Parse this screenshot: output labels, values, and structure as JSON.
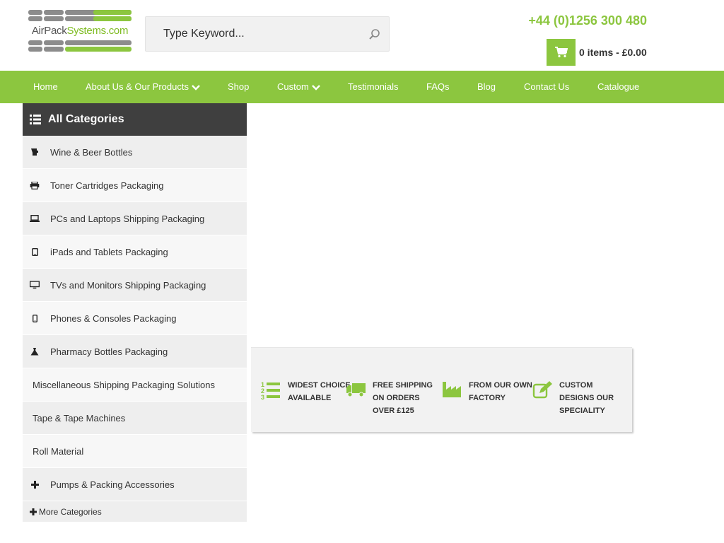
{
  "header": {
    "logo": {
      "left": "AirPack",
      "right": "Systems.com"
    },
    "search": {
      "placeholder": "Type Keyword..."
    },
    "phone": "+44 (0)1256 300 480",
    "cart": {
      "summary": "0 items - £0.00"
    }
  },
  "nav": {
    "items": [
      {
        "label": "Home"
      },
      {
        "label": "About Us & Our Products"
      },
      {
        "label": "Shop"
      },
      {
        "label": "Custom"
      },
      {
        "label": "Testimonials"
      },
      {
        "label": "FAQs"
      },
      {
        "label": "Blog"
      },
      {
        "label": "Contact Us"
      },
      {
        "label": "Catalogue"
      }
    ]
  },
  "sidebar": {
    "title": "All Categories",
    "items": [
      {
        "label": "Wine & Beer Bottles",
        "icon": "bottle-icon"
      },
      {
        "label": "Toner Cartridges Packaging",
        "icon": "printer-icon"
      },
      {
        "label": "PCs and Laptops Shipping Packaging",
        "icon": "laptop-icon"
      },
      {
        "label": "iPads and Tablets Packaging",
        "icon": "tablet-icon"
      },
      {
        "label": "TVs and Monitors Shipping Packaging",
        "icon": "monitor-icon"
      },
      {
        "label": "Phones & Consoles Packaging",
        "icon": "phone-icon"
      },
      {
        "label": "Pharmacy Bottles Packaging",
        "icon": "flask-icon"
      },
      {
        "label": "Miscellaneous Shipping Packaging Solutions",
        "icon": ""
      },
      {
        "label": "Tape & Tape Machines",
        "icon": ""
      },
      {
        "label": "Roll Material",
        "icon": ""
      },
      {
        "label": "Pumps & Packing Accessories",
        "icon": "plus-icon"
      }
    ],
    "more": "More Categories"
  },
  "features": {
    "items": [
      {
        "line1": "WIDEST CHOICE",
        "line2": "AVAILABLE",
        "line3": "",
        "icon": "numbered-list-icon"
      },
      {
        "line1": "FREE SHIPPING",
        "line2": "ON ORDERS",
        "line3": "OVER £125",
        "icon": "truck-icon"
      },
      {
        "line1": "FROM OUR OWN",
        "line2": "FACTORY",
        "line3": "",
        "icon": "factory-icon"
      },
      {
        "line1": "CUSTOM",
        "line2": "DESIGNS OUR",
        "line3": "SPECIALITY",
        "icon": "edit-icon"
      }
    ]
  },
  "colors": {
    "brand_green": "#8cc63f",
    "category_header": "#3f3f3f"
  }
}
